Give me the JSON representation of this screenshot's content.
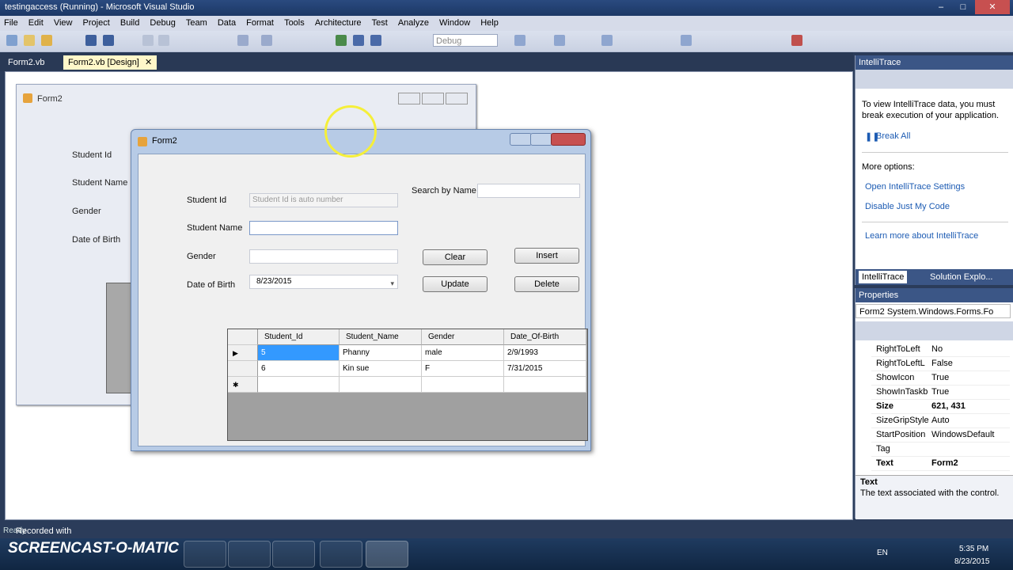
{
  "window": {
    "title": "testingaccess (Running) - Microsoft Visual Studio",
    "minimize": "–",
    "restore": "□",
    "close": "✕"
  },
  "menu": [
    "File",
    "Edit",
    "View",
    "Project",
    "Build",
    "Debug",
    "Team",
    "Data",
    "Format",
    "Tools",
    "Architecture",
    "Test",
    "Analyze",
    "Window",
    "Help"
  ],
  "toolbar": {
    "config": "Debug"
  },
  "tabs": [
    {
      "label": "Form2.vb"
    },
    {
      "label": "Form2.vb [Design]",
      "close": "✕"
    }
  ],
  "design_form": {
    "title": "Form2",
    "labels": [
      "Student Id",
      "Student Name",
      "Gender",
      "Date of Birth"
    ]
  },
  "running_form": {
    "title": "Form2",
    "labels": {
      "student_id": "Student Id",
      "student_name": "Student Name",
      "gender": "Gender",
      "dob": "Date of Birth",
      "search": "Search by Name"
    },
    "fields": {
      "student_id_placeholder": "Student Id is auto number",
      "student_name": "",
      "gender": "",
      "dob": "8/23/2015",
      "search": ""
    },
    "buttons": {
      "clear": "Clear",
      "insert": "Insert",
      "update": "Update",
      "delete": "Delete"
    },
    "grid": {
      "columns": [
        "Student_Id",
        "Student_Name",
        "Gender",
        "Date_Of-Birth"
      ],
      "rows": [
        {
          "marker": "▶",
          "cells": [
            "5",
            "Phanny",
            "male",
            "2/9/1993"
          ]
        },
        {
          "marker": "",
          "cells": [
            "6",
            "Kin sue",
            "F",
            "7/31/2015"
          ]
        },
        {
          "marker": "✱",
          "cells": [
            "",
            "",
            "",
            ""
          ]
        }
      ]
    }
  },
  "intellitrace": {
    "title": "IntelliTrace",
    "message": "To view IntelliTrace data, you must break execution of your application.",
    "break_all": "Break All",
    "more_options": "More options:",
    "open_settings": "Open IntelliTrace Settings",
    "disable_jmc": "Disable Just My Code",
    "learn_more": "Learn more about IntelliTrace",
    "tab1": "IntelliTrace",
    "tab2": "Solution Explo..."
  },
  "properties": {
    "title": "Properties",
    "object": "Form2  System.Windows.Forms.Fo",
    "rows": [
      [
        "RightToLeft",
        "No"
      ],
      [
        "RightToLeftL",
        "False"
      ],
      [
        "ShowIcon",
        "True"
      ],
      [
        "ShowInTaskb",
        "True"
      ],
      [
        "Size",
        "621, 431"
      ],
      [
        "SizeGripStyle",
        "Auto"
      ],
      [
        "StartPosition",
        "WindowsDefault"
      ],
      [
        "Tag",
        ""
      ],
      [
        "Text",
        "Form2"
      ]
    ],
    "desc_title": "Text",
    "desc_text": "The text associated with the control."
  },
  "status": {
    "left": "Ready",
    "recorded": "Recorded with",
    "brand": "SCREENCAST-O-MATIC"
  },
  "taskbar": {
    "lang": "EN",
    "time": "5:35 PM",
    "date": "8/23/2015"
  }
}
